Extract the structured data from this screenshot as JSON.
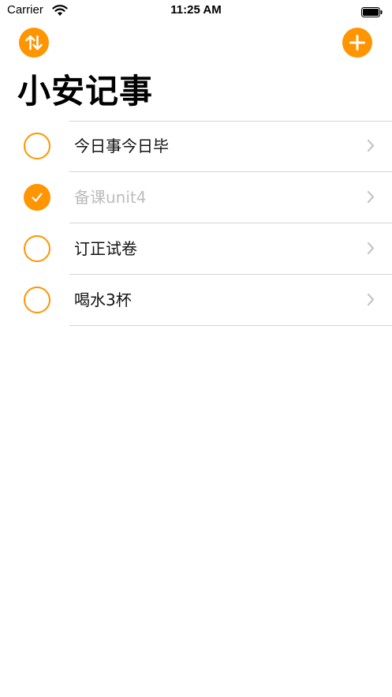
{
  "status_bar": {
    "carrier": "Carrier",
    "time": "11:25 AM"
  },
  "nav": {
    "sort_icon": "sort-arrows-icon",
    "add_icon": "plus-icon"
  },
  "page_title": "小安记事",
  "colors": {
    "accent": "#FF9500",
    "separator": "#d6d6d6",
    "done_text": "#bdbdbd"
  },
  "todos": [
    {
      "title": "今日事今日毕",
      "done": false
    },
    {
      "title": "备课unit4",
      "done": true
    },
    {
      "title": "订正试卷",
      "done": false
    },
    {
      "title": "喝水3杯",
      "done": false
    }
  ]
}
